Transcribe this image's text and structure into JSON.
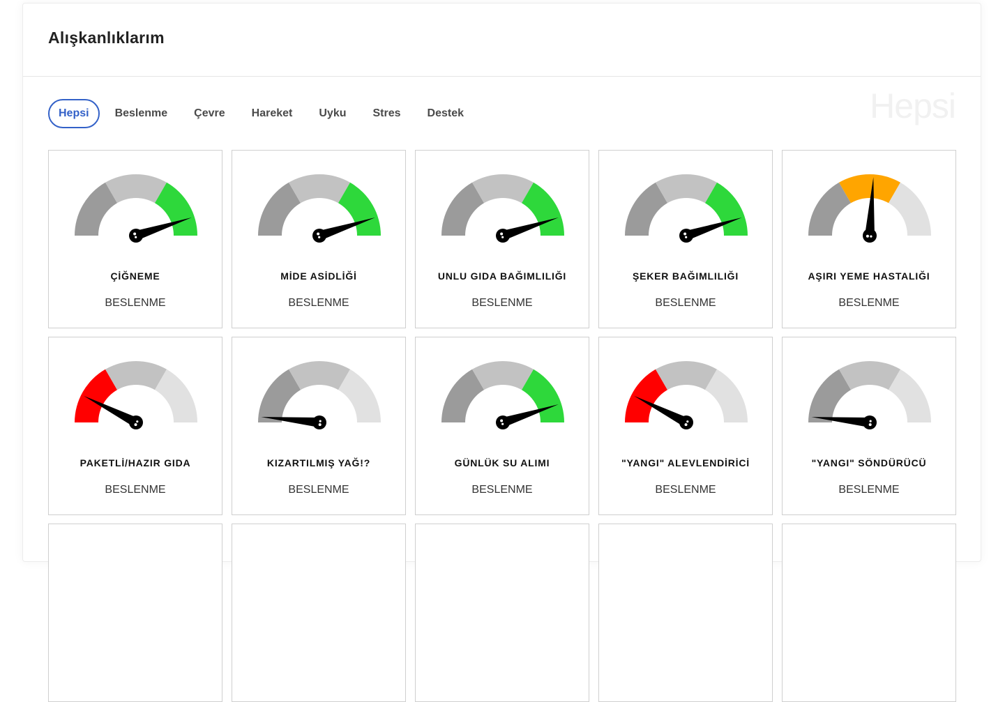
{
  "header": {
    "title": "Alışkanlıklarım"
  },
  "tabs": [
    {
      "label": "Hepsi",
      "active": true
    },
    {
      "label": "Beslenme"
    },
    {
      "label": "Çevre"
    },
    {
      "label": "Hareket"
    },
    {
      "label": "Uyku"
    },
    {
      "label": "Stres"
    },
    {
      "label": "Destek"
    }
  ],
  "watermark": "Hepsi",
  "colors": {
    "accent": "#3361c8",
    "green": "#2ed83b",
    "orange": "#ffa500",
    "red": "#ff0000",
    "dark_grey": "#9b9b9b",
    "mid_grey": "#c2c2c2",
    "light_grey": "#e1e1e1"
  },
  "cards": [
    {
      "title": "ÇİĞNEME",
      "category": "BESLENME",
      "active_segment": "green",
      "level": 0.9
    },
    {
      "title": "MİDE ASİDLİĞİ",
      "category": "BESLENME",
      "active_segment": "green",
      "level": 0.9
    },
    {
      "title": "UNLU GIDA BAĞIMLILIĞI",
      "category": "BESLENME",
      "active_segment": "green",
      "level": 0.9
    },
    {
      "title": "ŞEKER BAĞIMLILIĞI",
      "category": "BESLENME",
      "active_segment": "green",
      "level": 0.9
    },
    {
      "title": "AŞIRI YEME HASTALIĞI",
      "category": "BESLENME",
      "active_segment": "orange",
      "level": 0.52
    },
    {
      "title": "PAKETLİ/HAZIR GIDA",
      "category": "BESLENME",
      "active_segment": "red",
      "level": 0.15
    },
    {
      "title": "KIZARTILMIŞ YAĞ!?",
      "category": "BESLENME",
      "active_segment": "none",
      "level": 0.03
    },
    {
      "title": "GÜNLÜK SU ALIMI",
      "category": "BESLENME",
      "active_segment": "green",
      "level": 0.9
    },
    {
      "title": "\"YANGI\" ALEVLENDİRİCİ",
      "category": "BESLENME",
      "active_segment": "red",
      "level": 0.15
    },
    {
      "title": "\"YANGI\" SÖNDÜRÜCÜ",
      "category": "BESLENME",
      "active_segment": "none",
      "level": 0.03
    },
    {
      "title": "",
      "category": "",
      "active_segment": "none",
      "level": 0
    },
    {
      "title": "",
      "category": "",
      "active_segment": "none",
      "level": 0
    },
    {
      "title": "",
      "category": "",
      "active_segment": "none",
      "level": 0
    },
    {
      "title": "",
      "category": "",
      "active_segment": "none",
      "level": 0
    },
    {
      "title": "",
      "category": "",
      "active_segment": "none",
      "level": 0
    }
  ]
}
